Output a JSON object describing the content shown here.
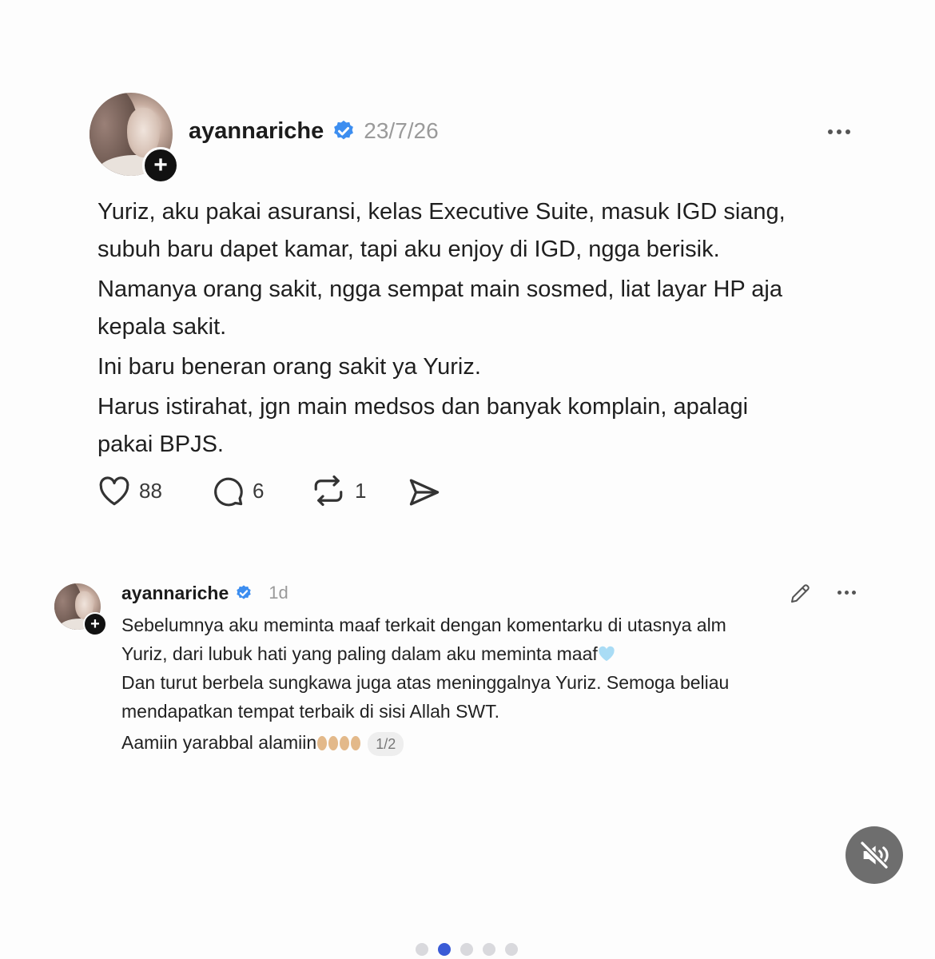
{
  "post": {
    "username": "ayannariche",
    "timestamp": "23/7/26",
    "paragraphs": [
      [
        "Yuriz, aku pakai asuransi, kelas Executive Suite, masuk IGD siang,",
        "subuh baru dapet kamar, tapi aku enjoy di IGD, ngga berisik."
      ],
      [
        "Namanya orang sakit, ngga sempat main sosmed, liat layar HP aja",
        "kepala sakit."
      ],
      [
        "Ini baru beneran orang sakit ya Yuriz."
      ],
      [
        "Harus istirahat, jgn main medsos dan banyak komplain, apalagi",
        "pakai BPJS."
      ]
    ],
    "actions": {
      "likes": "88",
      "comments": "6",
      "reposts": "1"
    }
  },
  "comment": {
    "username": "ayannariche",
    "timestamp": "1d",
    "lines": [
      "Sebelumnya aku meminta maaf terkait dengan komentarku di utasnya alm",
      "Yuriz, dari lubuk hati yang paling dalam aku meminta maaf",
      "Dan turut berbela sungkawa juga atas meninggalnya Yuriz. Semoga beliau",
      "mendapatkan tempat terbaik di sisi Allah SWT.",
      "Aamiin yarabbal alamiin"
    ],
    "page_indicator": "1/2"
  },
  "pager": {
    "total": 5,
    "active_index": 1
  },
  "colors": {
    "verified": "#3d8ef0",
    "pager_active": "#3a5bd6",
    "heart_emoji": "#a9dcf5",
    "pray_emoji": "#e3b98a"
  }
}
